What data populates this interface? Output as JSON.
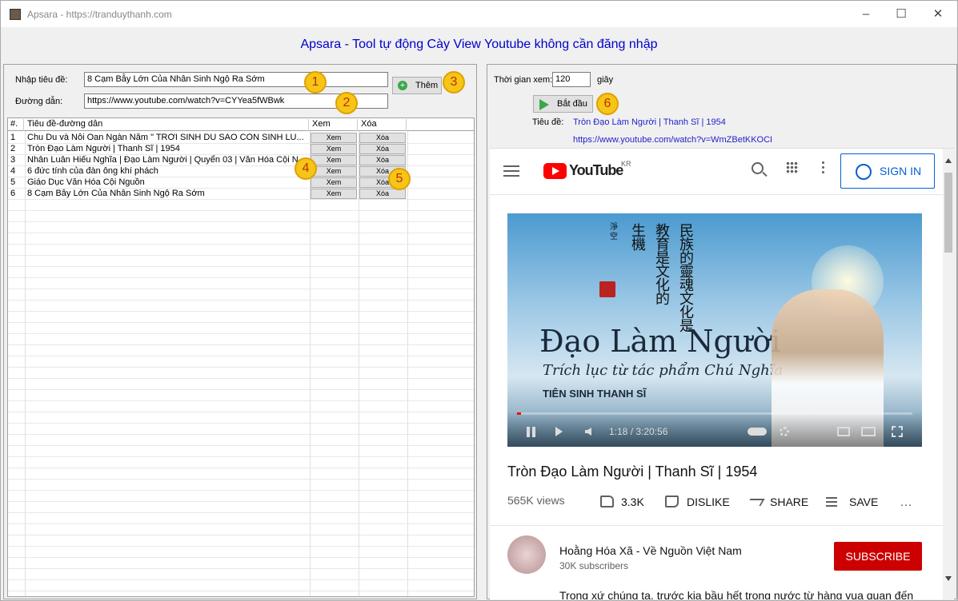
{
  "window": {
    "title": "Apsara - https://tranduythanh.com",
    "min": "–",
    "max": "☐",
    "close": "✕"
  },
  "heading": "Apsara - Tool tự động Cày View Youtube không cần đăng nhập",
  "form": {
    "title_label": "Nhập tiêu đề:",
    "title_value": "8 Cạm Bẫy Lớn Của Nhân Sinh Ngộ Ra Sớm",
    "url_label": "Đường dẫn:",
    "url_value": "https://www.youtube.com/watch?v=CYYea5fWBwk",
    "add_label": "Thêm"
  },
  "callouts": [
    "1",
    "2",
    "3",
    "4",
    "5",
    "6"
  ],
  "table": {
    "headers": [
      "#.",
      "Tiêu đề-đường dẫn",
      "Xem",
      "Xóa"
    ],
    "rows": [
      {
        "n": "1",
        "title": "Chu Du và Nỗi Oan Ngàn Năm \" TRỜI SINH DU SAO CÒN SINH LU...",
        "view": "Xem",
        "del": "Xóa"
      },
      {
        "n": "2",
        "title": "Tròn Đạo Làm Người | Thanh Sĩ | 1954",
        "view": "Xem",
        "del": "Xóa"
      },
      {
        "n": "3",
        "title": "Nhân Luân Hiếu Nghĩa | Đạo Làm Người | Quyển 03 | Văn Hóa Cội N...",
        "view": "Xem",
        "del": "Xóa"
      },
      {
        "n": "4",
        "title": "6 đức tính của đàn ông khí phách",
        "view": "Xem",
        "del": "Xóa"
      },
      {
        "n": "5",
        "title": "Giáo Dục Văn Hóa Cội Nguồn",
        "view": "Xem",
        "del": "Xóa"
      },
      {
        "n": "6",
        "title": "8 Cạm Bẫy Lớn Của Nhân Sinh Ngộ Ra Sớm",
        "view": "Xem",
        "del": "Xóa"
      }
    ]
  },
  "right": {
    "time_label": "Thời gian xem:",
    "time_value": "120",
    "unit": "giây",
    "start_label": "Bắt đầu",
    "title_label": "Tiêu đề:",
    "title_value": "Tròn Đạo Làm Người | Thanh Sĩ | 1954",
    "url_value": "https://www.youtube.com/watch?v=WmZBetKKOCI"
  },
  "yt": {
    "logo": "YouTube",
    "region": "KR",
    "sign_in": "SIGN IN",
    "video_title": "Tròn Đạo Làm Người | Thanh Sĩ | 1954",
    "views": "565K views",
    "likes": "3.3K",
    "dislike": "DISLIKE",
    "share": "SHARE",
    "save": "SAVE",
    "more": "…",
    "time": "1:18 / 3:20:56",
    "channel": "Hoằng Hóa Xã - Về Nguồn Việt Nam",
    "subs": "30K subscribers",
    "subscribe": "SUBSCRIBE",
    "desc": "Trong xứ chúng ta, trước kia bầu hết trong nước từ hàng vua quan đến",
    "thumb_title": "Đạo Làm Người",
    "thumb_sub": "Trích lục từ tác phẩm Chú Nghĩa",
    "thumb_author": "TIÊN SINH THANH SĨ",
    "calligraphy": [
      "民",
      "族",
      "的",
      "靈",
      "魂",
      "文",
      "化",
      "是",
      "教",
      "育",
      "是",
      "文",
      "化",
      "的",
      "生",
      "機",
      "淨",
      "空"
    ]
  },
  "colors": {
    "accent": "#0000cc",
    "link": "#2222cc",
    "yt_red": "#cc0000",
    "callout": "#f5c518"
  }
}
